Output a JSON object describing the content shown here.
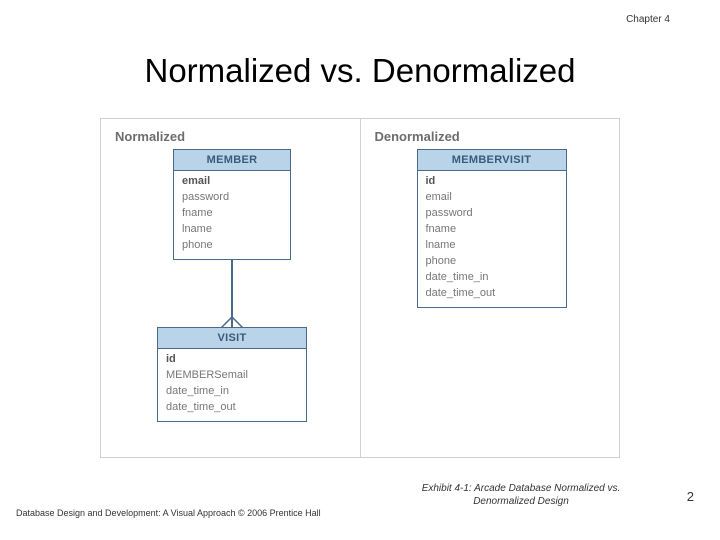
{
  "chapter": "Chapter 4",
  "title": "Normalized vs. Denormalized",
  "panels": {
    "left_label": "Normalized",
    "right_label": "Denormalized"
  },
  "tables": {
    "member": {
      "name": "MEMBER",
      "fields": [
        "email",
        "password",
        "fname",
        "lname",
        "phone"
      ],
      "pk_index": 0
    },
    "visit": {
      "name": "VISIT",
      "fields": [
        "id",
        "MEMBERSemail",
        "date_time_in",
        "date_time_out"
      ],
      "pk_index": 0
    },
    "membervisit": {
      "name": "MEMBERVISIT",
      "fields": [
        "id",
        "email",
        "password",
        "fname",
        "lname",
        "phone",
        "date_time_in",
        "date_time_out"
      ],
      "pk_index": 0
    }
  },
  "caption": "Exhibit 4-1: Arcade Database Normalized vs. Denormalized Design",
  "footer": "Database Design and Development: A Visual Approach   © 2006 Prentice Hall",
  "page": "2"
}
